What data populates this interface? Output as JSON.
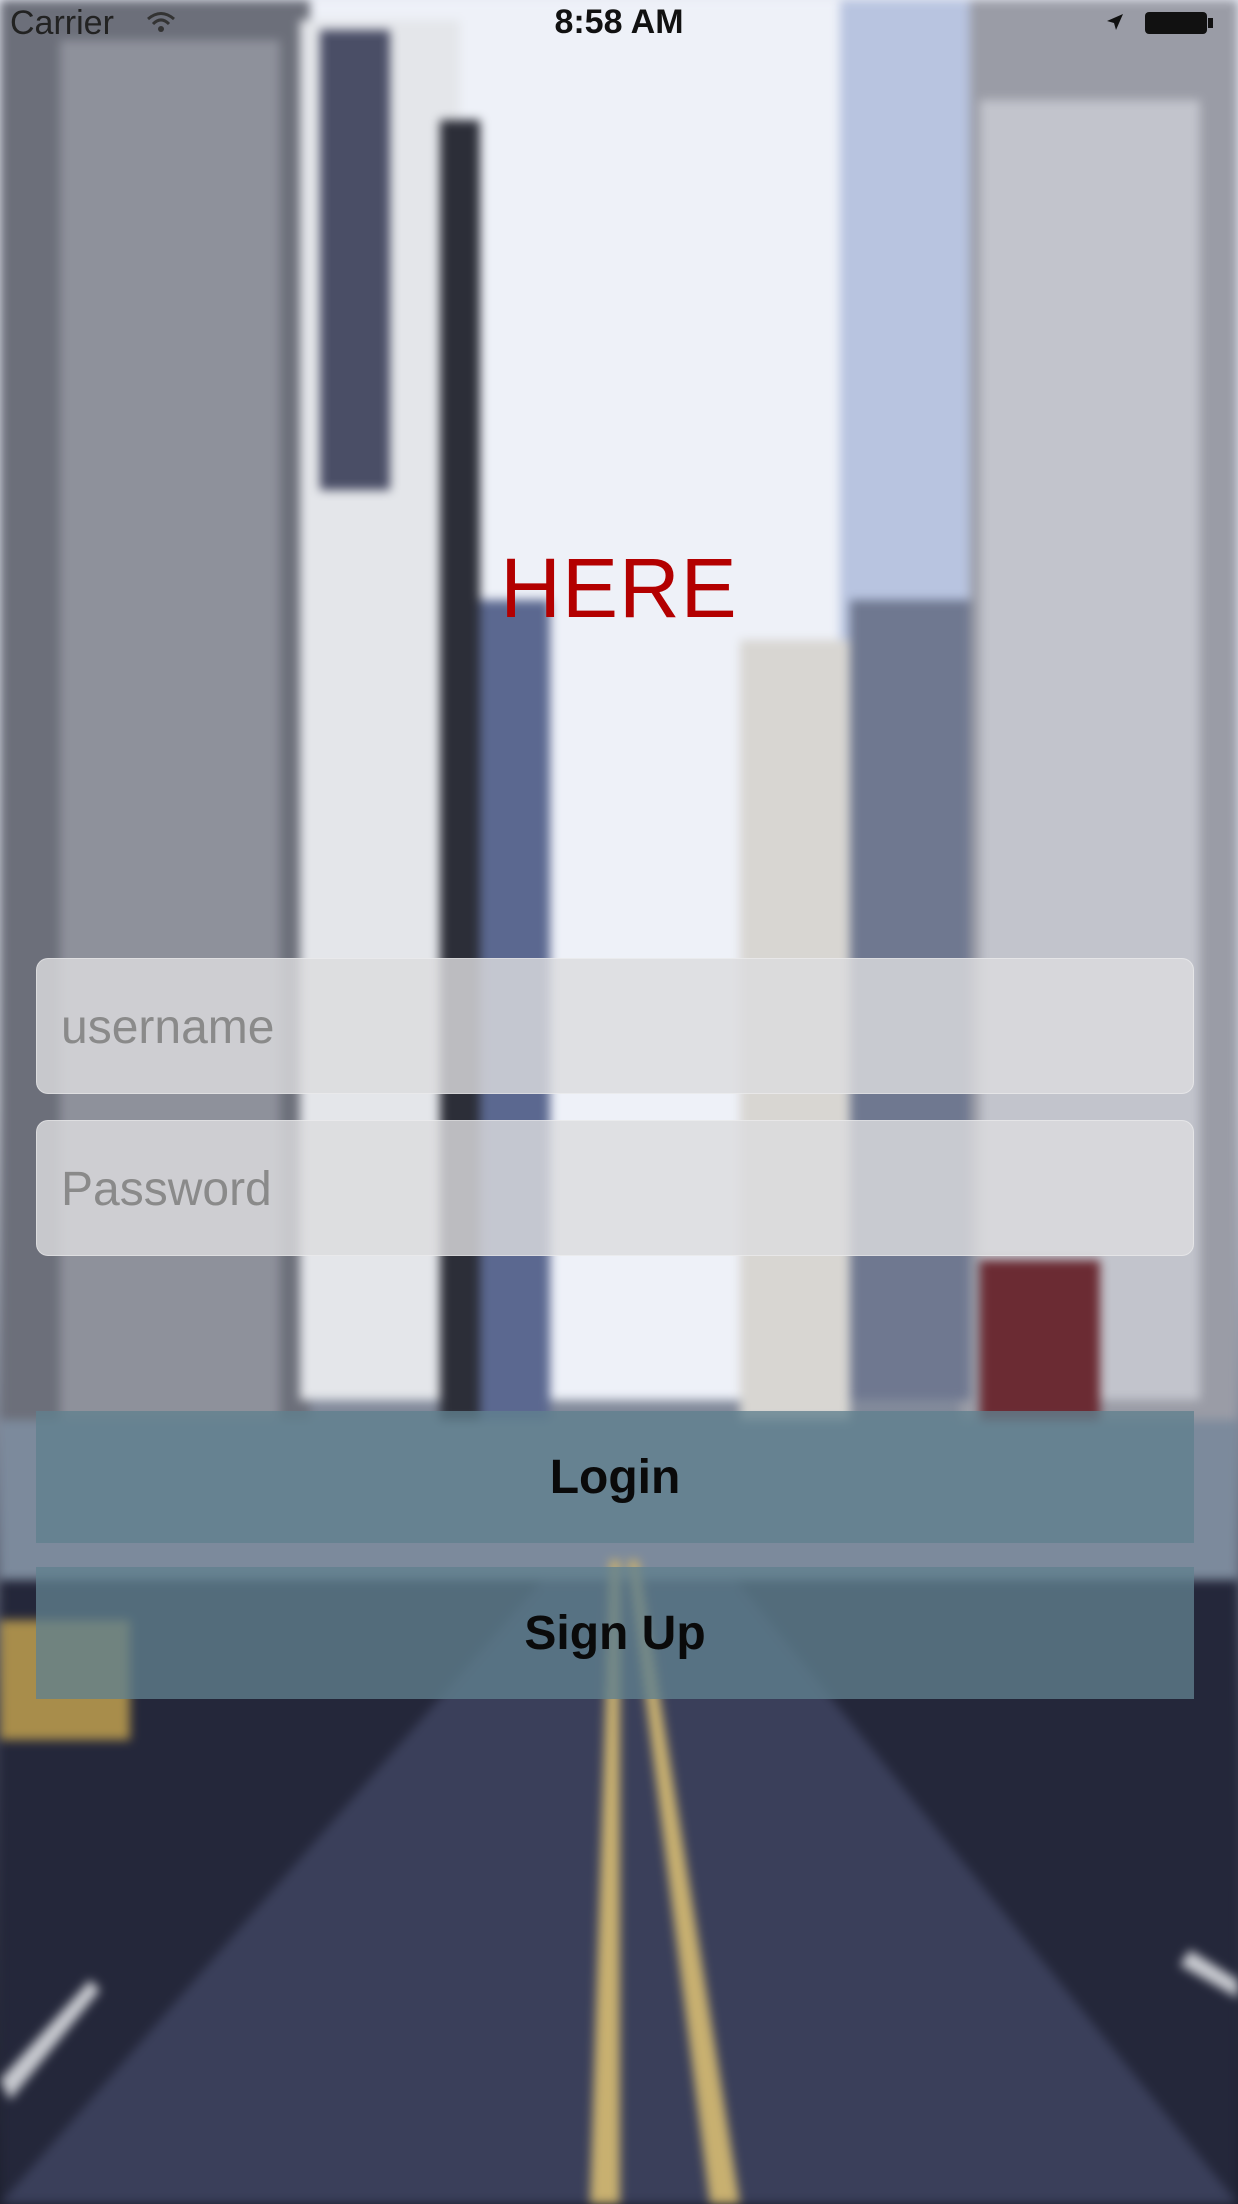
{
  "status_bar": {
    "carrier": "Carrier",
    "time": "8:58 AM",
    "wifi_icon": "wifi-icon",
    "location_icon": "location-arrow-icon",
    "battery_icon": "battery-icon"
  },
  "app": {
    "logo_text": "HERE",
    "logo_color": "#b30000"
  },
  "form": {
    "username_placeholder": "username",
    "username_value": "",
    "password_placeholder": "Password",
    "password_value": ""
  },
  "buttons": {
    "login_label": "Login",
    "signup_label": "Sign Up",
    "button_color": "#60808e"
  }
}
